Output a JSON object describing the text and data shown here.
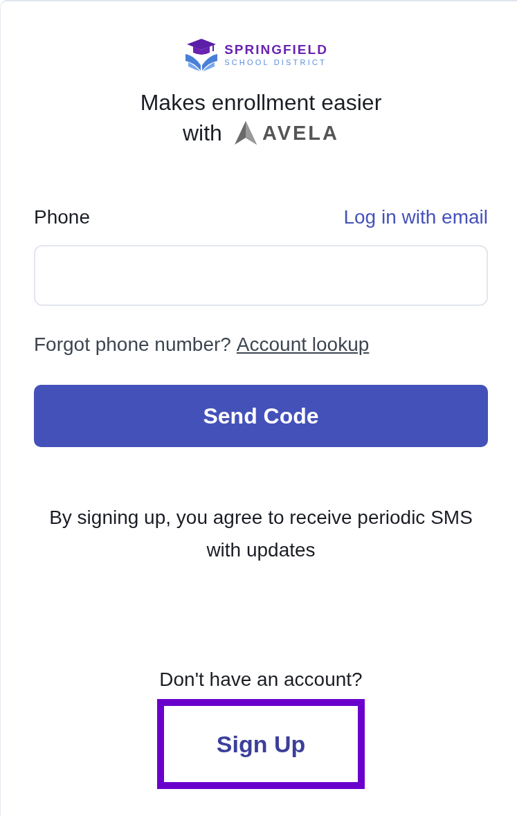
{
  "logo": {
    "name": "SPRINGFIELD",
    "subtitle": "SCHOOL DISTRICT"
  },
  "tagline": {
    "line_1": "Makes enrollment easier",
    "prefix": "with",
    "brand": "AVELA"
  },
  "phone": {
    "label": "Phone",
    "alt_link": "Log in with email"
  },
  "forgot": {
    "text": "Forgot phone number?",
    "link": "Account lookup"
  },
  "send_button": "Send Code",
  "notice": "By signing up, you agree to receive periodic SMS with updates",
  "signup": {
    "prompt": "Don't have an account?",
    "button": "Sign Up",
    "focused": true
  }
}
